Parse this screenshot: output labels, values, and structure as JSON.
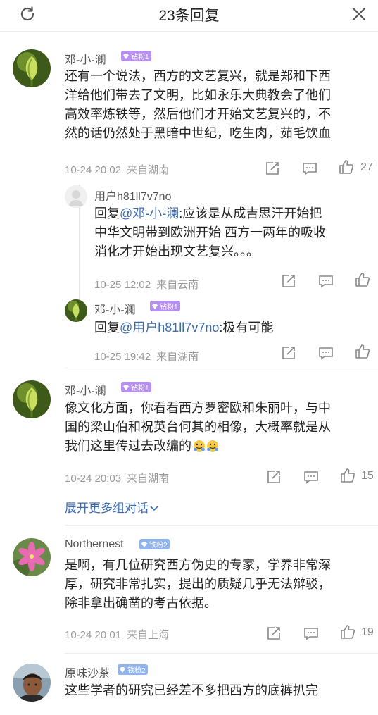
{
  "header": {
    "title": "23条回复"
  },
  "comments": [
    {
      "username": "邓-小-澜",
      "badge": "钻粉1",
      "text": [
        "还有一个说法，西方的文艺复兴，就是郑和下西",
        "洋给他们带去了文明，比如永乐大典教会了他们",
        "高效率炼铁等，然后他们才开始文艺复兴的，不",
        "然的话仍然处于黑暗中世纪，吃生肉，茹毛饮血"
      ],
      "time": "10-24 20:02",
      "location": "来自湖南",
      "likes": "27",
      "replies": [
        {
          "username": "用户h81ll7v7no",
          "prefix": "回复",
          "mention": "@邓-小-澜",
          "text": [
            ":应该是从成吉思汗开始把",
            "中华文明带到欧洲开始 西方一两年的吸收",
            "消化才开始出现文艺复兴。。。"
          ],
          "time": "10-25 12:02",
          "location": "来自云南"
        },
        {
          "username": "邓-小-澜",
          "badge": "钻粉1",
          "prefix": "回复",
          "mention": "@用户h81ll7v7no",
          "text": [
            ":极有可能"
          ],
          "time": "10-25 19:42",
          "location": "来自湖南"
        }
      ]
    },
    {
      "username": "邓-小-澜",
      "badge": "钻粉1",
      "text": [
        "像文化方面，你看看西方罗密欧和朱丽叶，与中",
        "国的梁山伯和祝英台何其的相像，大概率就是从",
        "我们这里传过去改编的"
      ],
      "time": "10-24 20:03",
      "location": "来自湖南",
      "likes": "15",
      "expand": "展开更多组对话"
    },
    {
      "username": "Northernest",
      "badge": "铁粉2",
      "text": [
        "是啊，有几位研究西方伪史的专家，学养非常深",
        "厚，研究非常扎实，提出的质疑几乎无法辩驳，",
        "除非拿出确凿的考古依据。"
      ],
      "time": "10-24 20:01",
      "location": "来自上海",
      "likes": "19"
    },
    {
      "username": "原味沙茶",
      "badge": "铁粉2",
      "text": [
        "这些学者的研究已经差不多把西方的底裤扒完"
      ]
    }
  ],
  "colors": {
    "link": "#3c6db3",
    "badge_purple": "#b68ff1",
    "badge_blue": "#8fb4ee"
  }
}
